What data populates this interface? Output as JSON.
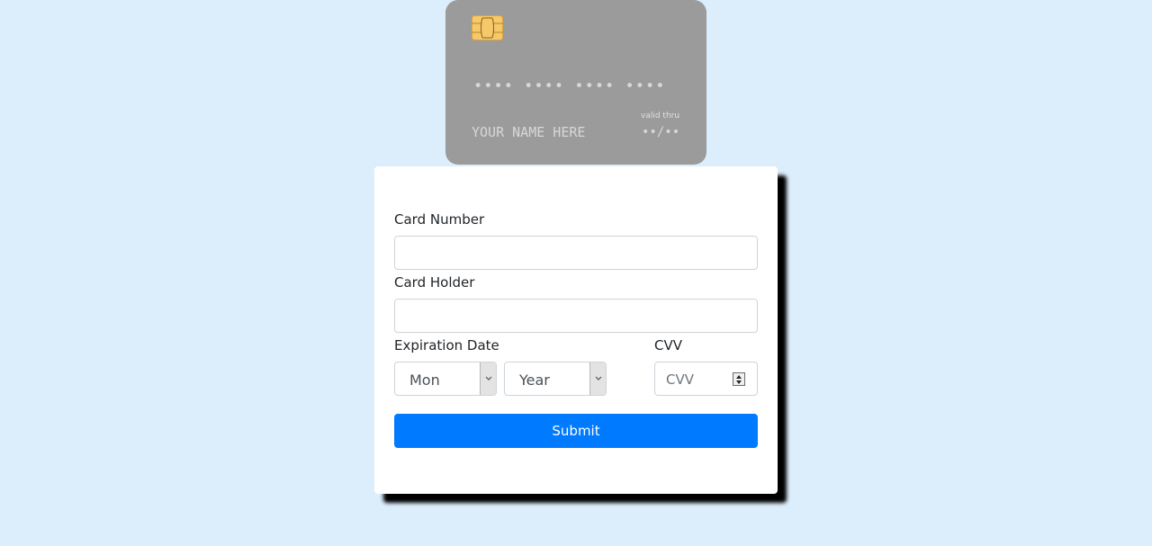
{
  "card_preview": {
    "number_mask": "•••• •••• •••• ••••",
    "name_placeholder": "YOUR NAME HERE",
    "valid_thru_label": "valid thru",
    "expiry_mask": "••/••"
  },
  "form": {
    "card_number_label": "Card Number",
    "card_number_value": "",
    "card_holder_label": "Card Holder",
    "card_holder_value": "",
    "expiration_label": "Expiration Date",
    "month_selected": "Mon",
    "year_selected": "Year",
    "cvv_label": "CVV",
    "cvv_placeholder": "CVV",
    "submit_label": "Submit"
  },
  "colors": {
    "background": "#dcedfc",
    "card": "#9b9b9b",
    "chip": "#f5c86a",
    "primary": "#007bff"
  },
  "icons": {
    "chip": "card-chip-icon",
    "select_arrow": "chevron-down-icon"
  }
}
